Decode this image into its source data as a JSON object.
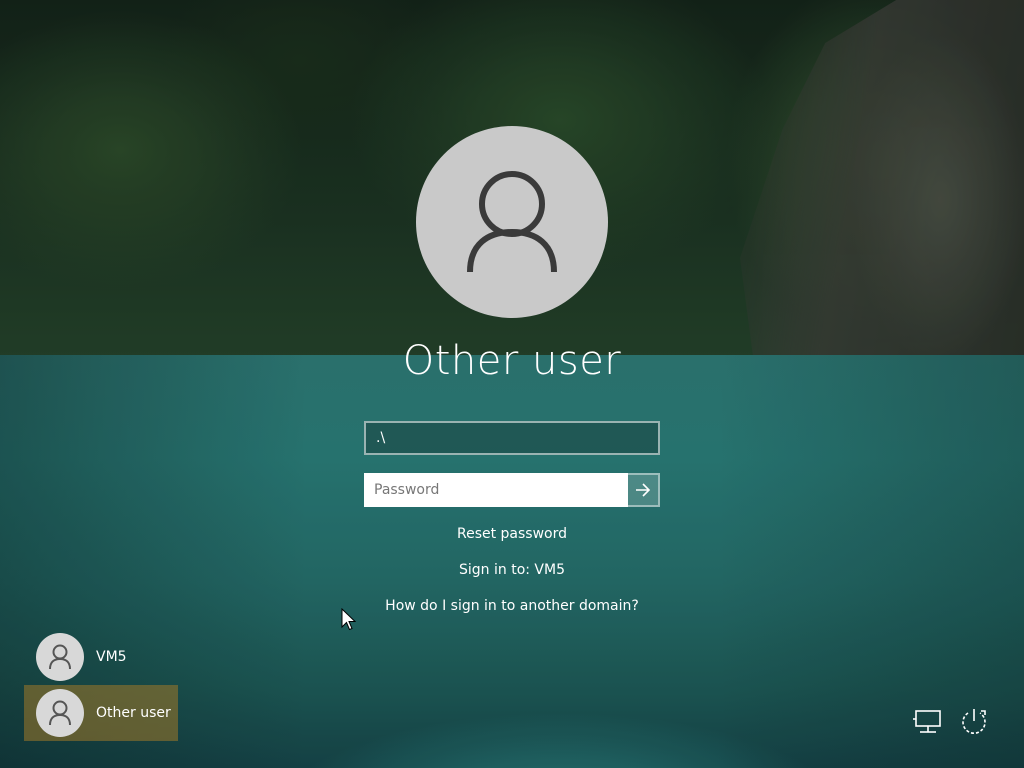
{
  "screen": {
    "accent_selected": "#a07828",
    "avatar_bg": "#c9c9c9"
  },
  "signin": {
    "avatar_icon": "user-silhouette-icon",
    "title": "Other user",
    "username_value": ".\\",
    "password_placeholder": "Password",
    "submit_icon": "arrow-right-icon",
    "reset_password": "Reset password",
    "sign_in_to": "Sign in to: VM5",
    "other_domain": "How do I sign in to another domain?"
  },
  "user_list": {
    "items": [
      {
        "name": "VM5",
        "icon": "user-silhouette-icon",
        "selected": false
      },
      {
        "name": "Other user",
        "icon": "user-silhouette-icon",
        "selected": true
      }
    ]
  },
  "system_tray": {
    "network_icon": "network-icon",
    "power_icon": "power-icon"
  }
}
